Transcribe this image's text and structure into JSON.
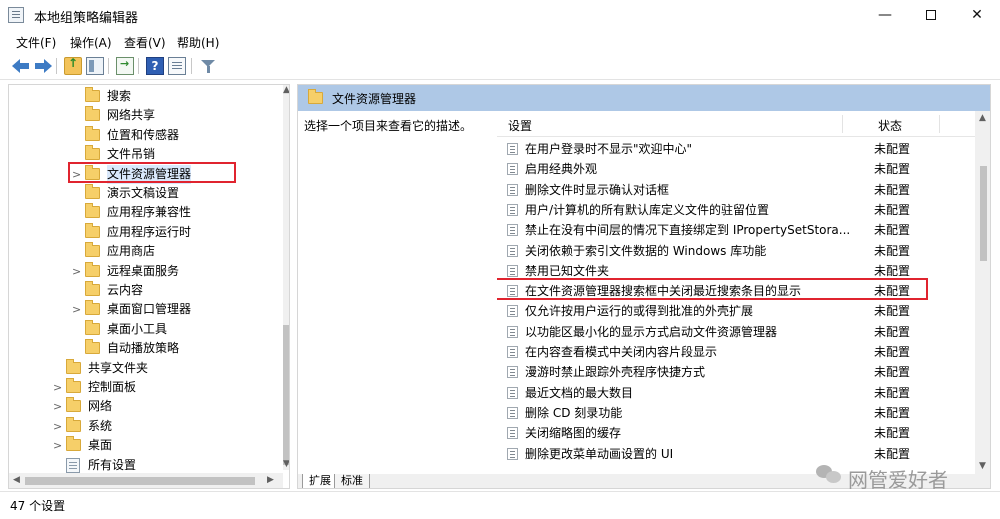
{
  "window": {
    "title": "本地组策略编辑器",
    "minimize": "—",
    "close": "✕"
  },
  "menu": [
    "文件(F)",
    "操作(A)",
    "查看(V)",
    "帮助(H)"
  ],
  "toolbar": {
    "help_glyph": "?"
  },
  "tree": [
    {
      "label": "搜索",
      "level": 2,
      "expander": "",
      "type": "folder"
    },
    {
      "label": "网络共享",
      "level": 2,
      "expander": "",
      "type": "folder"
    },
    {
      "label": "位置和传感器",
      "level": 2,
      "expander": "",
      "type": "folder"
    },
    {
      "label": "文件吊销",
      "level": 2,
      "expander": "",
      "type": "folder"
    },
    {
      "label": "文件资源管理器",
      "level": 2,
      "expander": ">",
      "type": "folder",
      "selected": true
    },
    {
      "label": "演示文稿设置",
      "level": 2,
      "expander": "",
      "type": "folder"
    },
    {
      "label": "应用程序兼容性",
      "level": 2,
      "expander": "",
      "type": "folder"
    },
    {
      "label": "应用程序运行时",
      "level": 2,
      "expander": "",
      "type": "folder"
    },
    {
      "label": "应用商店",
      "level": 2,
      "expander": "",
      "type": "folder"
    },
    {
      "label": "远程桌面服务",
      "level": 2,
      "expander": ">",
      "type": "folder"
    },
    {
      "label": "云内容",
      "level": 2,
      "expander": "",
      "type": "folder"
    },
    {
      "label": "桌面窗口管理器",
      "level": 2,
      "expander": ">",
      "type": "folder"
    },
    {
      "label": "桌面小工具",
      "level": 2,
      "expander": "",
      "type": "folder"
    },
    {
      "label": "自动播放策略",
      "level": 2,
      "expander": "",
      "type": "folder"
    },
    {
      "label": "共享文件夹",
      "level": 1,
      "expander": "",
      "type": "folder"
    },
    {
      "label": "控制面板",
      "level": 1,
      "expander": ">",
      "type": "folder"
    },
    {
      "label": "网络",
      "level": 1,
      "expander": ">",
      "type": "folder"
    },
    {
      "label": "系统",
      "level": 1,
      "expander": ">",
      "type": "folder"
    },
    {
      "label": "桌面",
      "level": 1,
      "expander": ">",
      "type": "folder"
    },
    {
      "label": "所有设置",
      "level": 1,
      "expander": "",
      "type": "settings"
    }
  ],
  "right": {
    "header_title": "文件资源管理器",
    "description": "选择一个项目来查看它的描述。",
    "columns": {
      "setting": "设置",
      "state": "状态"
    },
    "policies": [
      {
        "name": "在用户登录时不显示\"欢迎中心\"",
        "state": "未配置"
      },
      {
        "name": "启用经典外观",
        "state": "未配置"
      },
      {
        "name": "删除文件时显示确认对话框",
        "state": "未配置"
      },
      {
        "name": "用户/计算机的所有默认库定义文件的驻留位置",
        "state": "未配置"
      },
      {
        "name": "禁止在没有中间层的情况下直接绑定到 IPropertySetStora...",
        "state": "未配置"
      },
      {
        "name": "关闭依赖于索引文件数据的 Windows 库功能",
        "state": "未配置"
      },
      {
        "name": "禁用已知文件夹",
        "state": "未配置"
      },
      {
        "name": "在文件资源管理器搜索框中关闭最近搜索条目的显示",
        "state": "未配置",
        "highlighted": true
      },
      {
        "name": "仅允许按用户运行的或得到批准的外壳扩展",
        "state": "未配置"
      },
      {
        "name": "以功能区最小化的显示方式启动文件资源管理器",
        "state": "未配置"
      },
      {
        "name": "在内容查看模式中关闭内容片段显示",
        "state": "未配置"
      },
      {
        "name": "漫游时禁止跟踪外壳程序快捷方式",
        "state": "未配置"
      },
      {
        "name": "最近文档的最大数目",
        "state": "未配置"
      },
      {
        "name": "删除 CD 刻录功能",
        "state": "未配置"
      },
      {
        "name": "关闭缩略图的缓存",
        "state": "未配置"
      },
      {
        "name": "删除更改菜单动画设置的 UI",
        "state": "未配置"
      }
    ],
    "tabs": [
      "扩展",
      "标准"
    ]
  },
  "status": {
    "text": "47 个设置"
  },
  "watermark": {
    "text": "网管爱好者"
  },
  "colors": {
    "header_bg": "#aec8e6",
    "highlight_border": "#e0242f",
    "folder": "#f6cf69"
  }
}
